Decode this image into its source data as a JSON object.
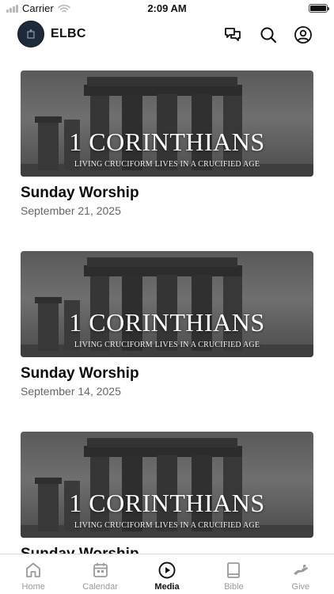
{
  "status_bar": {
    "carrier": "Carrier",
    "time": "2:09 AM"
  },
  "header": {
    "app_title": "ELBC",
    "icons": [
      "chat-icon",
      "search-icon",
      "profile-icon"
    ]
  },
  "sermons": [
    {
      "banner_title": "1 CORINTHIANS",
      "banner_subtitle": "LIVING CRUCIFORM LIVES IN A CRUCIFIED AGE",
      "title": "Sunday Worship",
      "date": "September 21, 2025"
    },
    {
      "banner_title": "1 CORINTHIANS",
      "banner_subtitle": "LIVING CRUCIFORM LIVES IN A CRUCIFIED AGE",
      "title": "Sunday Worship",
      "date": "September 14, 2025"
    },
    {
      "banner_title": "1 CORINTHIANS",
      "banner_subtitle": "LIVING CRUCIFORM LIVES IN A CRUCIFIED AGE",
      "title": "Sunday Worship",
      "date": ""
    }
  ],
  "tabs": [
    {
      "label": "Home",
      "icon": "home-icon",
      "active": false
    },
    {
      "label": "Calendar",
      "icon": "calendar-icon",
      "active": false
    },
    {
      "label": "Media",
      "icon": "play-icon",
      "active": true
    },
    {
      "label": "Bible",
      "icon": "book-icon",
      "active": false
    },
    {
      "label": "Give",
      "icon": "give-hand-icon",
      "active": false
    }
  ],
  "colors": {
    "active_tab": "#111111",
    "inactive_tab": "#9a9a9a",
    "avatar_bg": "#1c2a3a"
  }
}
